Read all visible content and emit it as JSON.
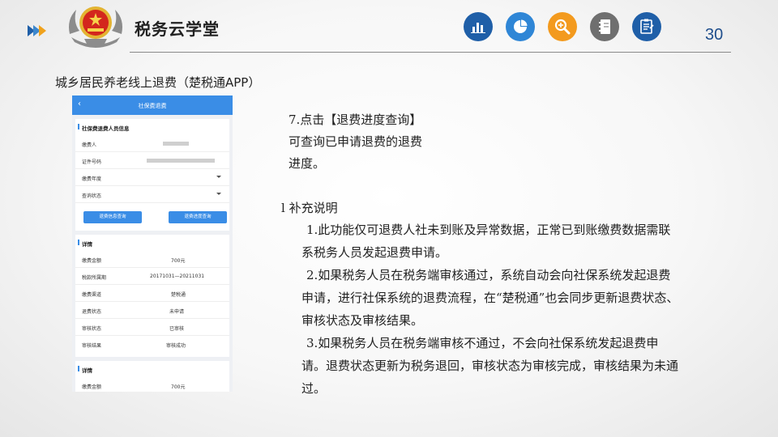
{
  "header": {
    "brand": "税务云学堂",
    "page_number": "30",
    "icons": [
      {
        "name": "bar-chart-icon",
        "color": "#1f5fa8"
      },
      {
        "name": "pie-chart-icon",
        "color": "#2f86d6"
      },
      {
        "name": "search-zoom-icon",
        "color": "#f39a1e"
      },
      {
        "name": "notebook-icon",
        "color": "#6f6f6f"
      },
      {
        "name": "checklist-icon",
        "color": "#1f5fa8"
      }
    ]
  },
  "subtitle": "城乡居民养老线上退费（楚税通APP）",
  "phone": {
    "title": "社保费退费",
    "back_glyph": "‹",
    "section1": {
      "title": "社保费退费人员信息",
      "rows": [
        {
          "label": "缴费人"
        },
        {
          "label": "证件号码"
        },
        {
          "label": "缴费年度"
        },
        {
          "label": "查询状态"
        }
      ],
      "buttons": [
        "退费信息查询",
        "退费进度查询"
      ]
    },
    "section2": {
      "title": "详情",
      "rows": [
        {
          "label": "缴费金额",
          "value": "700元"
        },
        {
          "label": "税款所属期",
          "value": "20171031—20211031"
        },
        {
          "label": "缴费渠道",
          "value": "楚税通"
        },
        {
          "label": "退费状态",
          "value": "未申请"
        },
        {
          "label": "审核状态",
          "value": "已审核"
        },
        {
          "label": "审核结果",
          "value": "审核成功"
        }
      ]
    },
    "section3": {
      "title": "详情",
      "rows": [
        {
          "label": "缴费金额",
          "value": "700元"
        }
      ]
    }
  },
  "step": {
    "line1": "7.点击【退费进度查询】",
    "line2": "可查询已申请退费的退费",
    "line3": "进度。"
  },
  "supplement": {
    "heading": "l 补充说明",
    "items": [
      "1.此功能仅可退费人社未到账及异常数据，正常已到账缴费数据需联系税务人员发起退费申请。",
      "2.如果税务人员在税务端审核通过，系统自动会向社保系统发起退费申请，进行社保系统的退费流程，在“楚税通”也会同步更新退费状态、审核状态及审核结果。",
      "3.如果税务人员在税务端审核不通过，不会向社保系统发起退费申请。退费状态更新为税务退回，审核状态为审核完成，审核结果为未通过。"
    ]
  }
}
